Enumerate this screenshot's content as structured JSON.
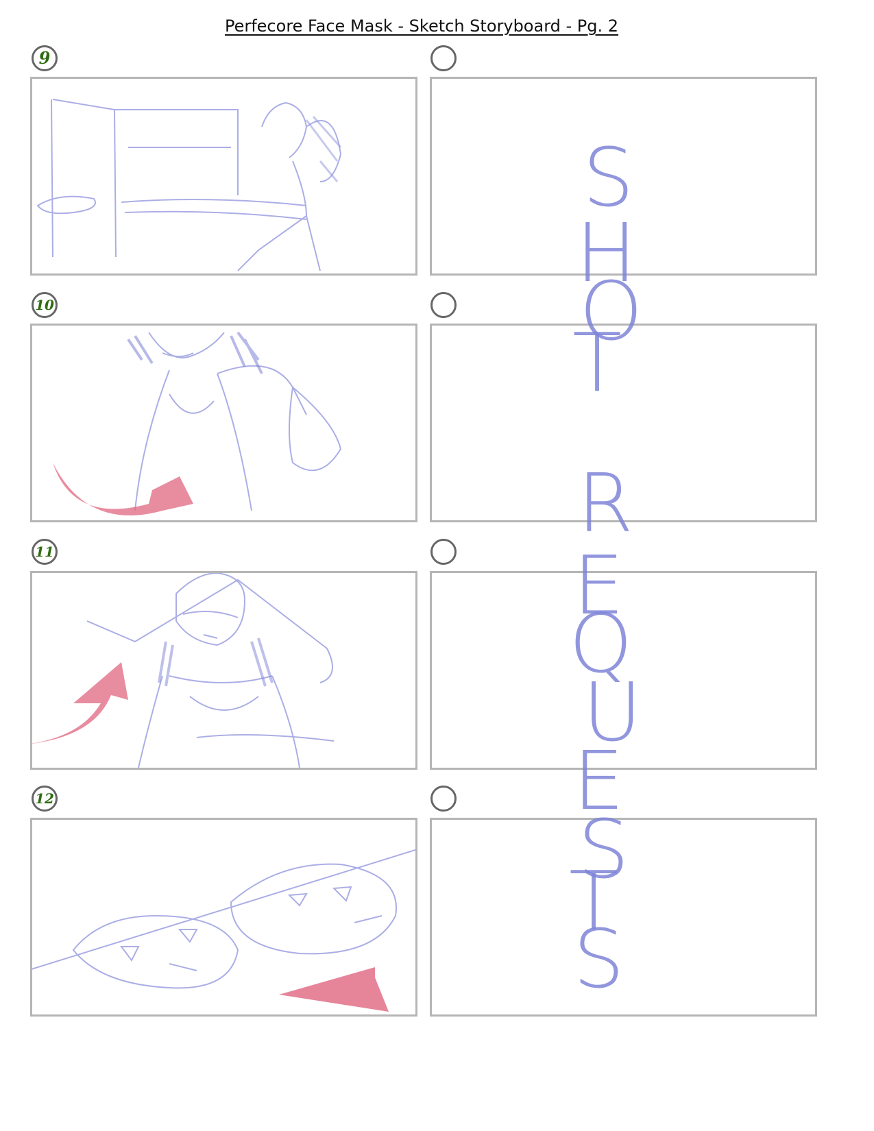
{
  "page": {
    "title": "Perfecore Face Mask - Sketch Storyboard - Pg. 2"
  },
  "panels": [
    {
      "number": "9",
      "description": "woman reaching toward mask on counter"
    },
    {
      "number": "10",
      "description": "woman smiling, holding mask, red motion arrow"
    },
    {
      "number": "11",
      "description": "woman wearing mask in bed, red motion arrow"
    },
    {
      "number": "12",
      "description": "two masks close-up, red motion arrow"
    }
  ],
  "overlay_text": [
    "S",
    "H",
    "O",
    "T",
    "R",
    "E",
    "Q",
    "U",
    "E",
    "S",
    "T",
    "S"
  ],
  "colors": {
    "sketch": "#7e84d8",
    "arrow": "#e0667f",
    "number": "#2f6b12",
    "frame": "#b5b5b5"
  }
}
